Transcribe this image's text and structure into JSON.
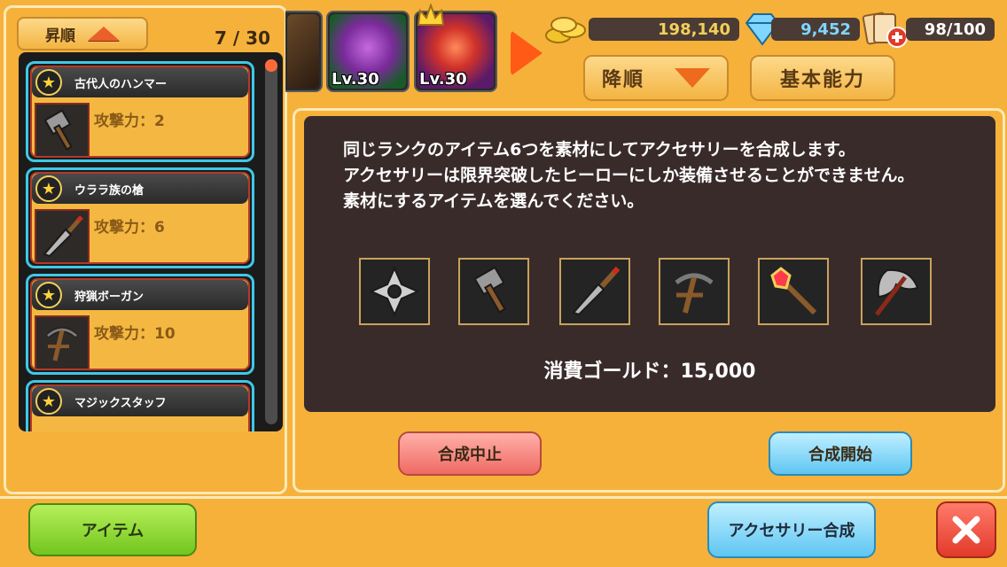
{
  "list": {
    "sort_label": "昇順",
    "count": "7 / 30",
    "items": [
      {
        "name": "古代人のハンマー",
        "stat": "攻撃力：2",
        "icon": "hammer-icon"
      },
      {
        "name": "ウララ族の槍",
        "stat": "攻撃力：6",
        "icon": "spear-icon"
      },
      {
        "name": "狩猟ボーガン",
        "stat": "攻撃力：10",
        "icon": "crossbow-icon"
      },
      {
        "name": "マジックスタッフ",
        "stat": "",
        "icon": "staff-icon"
      }
    ]
  },
  "heroes": [
    {
      "level": "",
      "icon": "wizard-hero-icon"
    },
    {
      "level": "Lv.30",
      "icon": "dragon-hero-icon"
    },
    {
      "level": "Lv.30",
      "icon": "queen-hero-icon"
    }
  ],
  "resources": {
    "gold": "198,140",
    "gems": "9,452",
    "cards": "98/100"
  },
  "header": {
    "sort_desc_label": "降順",
    "basic_stats_label": "基本能力"
  },
  "synthesis": {
    "description": [
      "同じランクのアイテム6つを素材にしてアクセサリーを合成します。",
      "アクセサリーは限界突破したヒーローにしか装備させることができません。",
      "素材にするアイテムを選んでください。"
    ],
    "materials": [
      "shuriken-icon",
      "hammer-icon",
      "spear-icon",
      "crossbow-icon",
      "staff-icon",
      "axe-icon"
    ],
    "gold_cost": "消費ゴールド：15,000",
    "cancel_label": "合成中止",
    "start_label": "合成開始"
  },
  "footer": {
    "items_label": "アイテム",
    "accessory_label": "アクセサリー合成"
  },
  "colors": {
    "panel": "#f6b13a",
    "dark": "#3a2b2b",
    "accent_blue": "#3fc8e6",
    "gold_text": "#f3cf5a",
    "gem_text": "#7fd6ff"
  }
}
